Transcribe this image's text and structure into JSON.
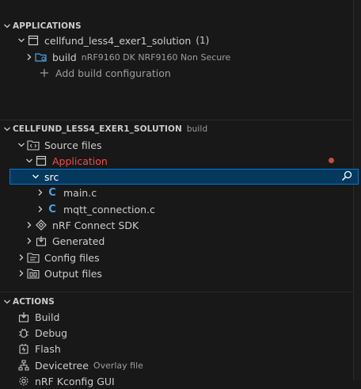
{
  "applications": {
    "title": "APPLICATIONS",
    "app_name": "cellfund_less4_exer1_solution",
    "app_count": "(1)",
    "build_label": "build",
    "build_desc": "nRF9160 DK NRF9160 Non Secure",
    "add_build": "Add build configuration"
  },
  "explorer": {
    "title": "CELLFUND_LESS4_EXER1_SOLUTION",
    "title_desc": "build",
    "source_files": "Source files",
    "application": "Application",
    "src": "src",
    "main_c": "main.c",
    "mqtt_c": "mqtt_connection.c",
    "sdk": "nRF Connect SDK",
    "generated": "Generated",
    "config_files": "Config files",
    "output_files": "Output files"
  },
  "actions": {
    "title": "ACTIONS",
    "build": "Build",
    "debug": "Debug",
    "flash": "Flash",
    "devicetree": "Devicetree",
    "devicetree_desc": "Overlay file",
    "kconfig": "nRF Kconfig GUI"
  },
  "colors": {
    "background": "#181818",
    "selection": "#04395e",
    "focus_border": "#0078d4",
    "error": "#f14c4c",
    "c_icon": "#4aa3e6"
  }
}
